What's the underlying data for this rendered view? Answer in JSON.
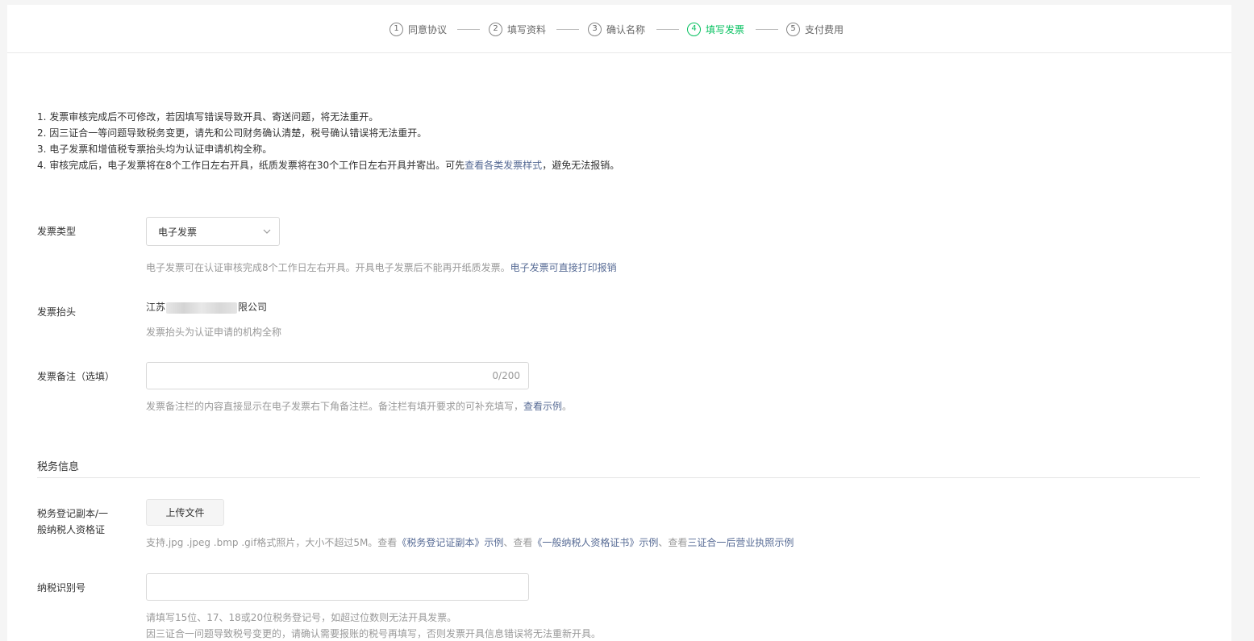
{
  "steps": [
    {
      "num": "1",
      "label": "同意协议",
      "active": false
    },
    {
      "num": "2",
      "label": "填写资料",
      "active": false
    },
    {
      "num": "3",
      "label": "确认名称",
      "active": false
    },
    {
      "num": "4",
      "label": "填写发票",
      "active": true
    },
    {
      "num": "5",
      "label": "支付费用",
      "active": false
    }
  ],
  "notes": {
    "line1": "1. 发票审核完成后不可修改，若因填写错误导致开具、寄送问题，将无法重开。",
    "line2": "2. 因三证合一等问题导致税务变更，请先和公司财务确认清楚，税号确认错误将无法重开。",
    "line3": "3. 电子发票和增值税专票抬头均为认证申请机构全称。",
    "line4_prefix": "4. 审核完成后，电子发票将在8个工作日左右开具，纸质发票将在30个工作日左右开具并寄出。可先",
    "line4_link": "查看各类发票样式",
    "line4_suffix": "，避免无法报销。"
  },
  "invoice_type": {
    "label": "发票类型",
    "value": "电子发票",
    "hint_prefix": "电子发票可在认证审核完成8个工作日左右开具。开具电子发票后不能再开纸质发票。",
    "hint_link": "电子发票可直接打印报销"
  },
  "invoice_title": {
    "label": "发票抬头",
    "value_prefix": "江苏",
    "value_suffix": "限公司",
    "hint": "发票抬头为认证申请的机构全称"
  },
  "invoice_remark": {
    "label": "发票备注（选填）",
    "counter": "0/200",
    "hint_prefix": "发票备注栏的内容直接显示在电子发票右下角备注栏。备注栏有填开要求的可补充填写，",
    "hint_link": "查看示例",
    "hint_suffix": "。"
  },
  "tax_section": {
    "title": "税务信息"
  },
  "tax_cert": {
    "label_line1": "税务登记副本/一",
    "label_line2": "般纳税人资格证",
    "button": "上传文件",
    "hint_prefix": "支持.jpg .jpeg .bmp .gif格式照片，大小不超过5M。查看",
    "link1": "《税务登记证副本》示例",
    "sep1": "、查看",
    "link2": "《一般纳税人资格证书》示例",
    "sep2": "、查看",
    "link3": "三证合一后营业执照示例"
  },
  "tax_id": {
    "label": "纳税识别号",
    "hint1": "请填写15位、17、18或20位税务登记号，如超过位数则无法开具发票。",
    "hint2": "因三证合一问题导致税号变更的，请确认需要报账的税号再填写，否则发票开具信息错误将无法重新开具。"
  },
  "colors": {
    "accent": "#07c160",
    "link": "#576b95"
  }
}
